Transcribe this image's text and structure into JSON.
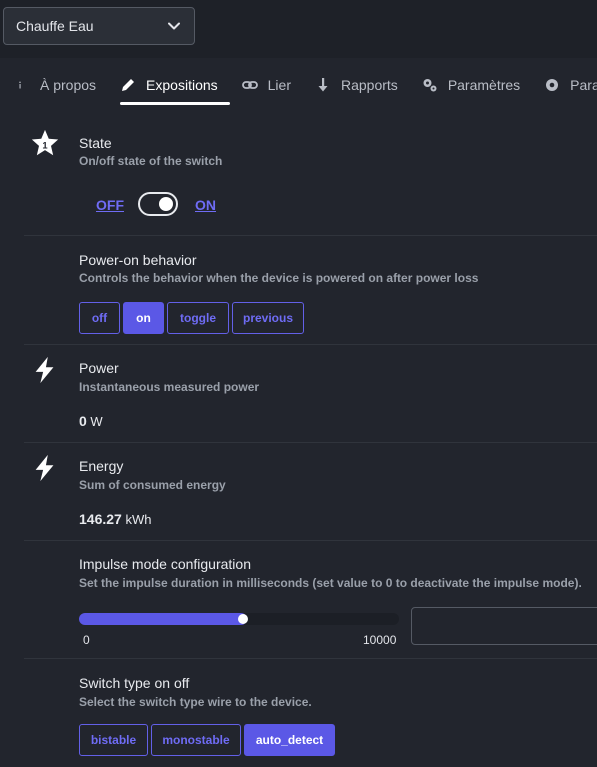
{
  "device_select": {
    "value": "Chauffe Eau"
  },
  "tabs": [
    {
      "label": "À propos",
      "icon": "info-icon"
    },
    {
      "label": "Expositions",
      "icon": "pencil-icon",
      "active": true
    },
    {
      "label": "Lier",
      "icon": "link-icon"
    },
    {
      "label": "Rapports",
      "icon": "arrow-down-icon"
    },
    {
      "label": "Paramètres",
      "icon": "cogs-icon"
    },
    {
      "label": "Param",
      "icon": "gear-icon"
    }
  ],
  "state": {
    "title": "State",
    "description": "On/off state of the switch",
    "off_label": "OFF",
    "on_label": "ON",
    "value": "ON"
  },
  "power_on_behavior": {
    "title": "Power-on behavior",
    "description": "Controls the behavior when the device is powered on after power loss",
    "options": [
      "off",
      "on",
      "toggle",
      "previous"
    ],
    "selected": "on"
  },
  "power": {
    "title": "Power",
    "description": "Instantaneous measured power",
    "value": "0",
    "unit": "W"
  },
  "energy": {
    "title": "Energy",
    "description": "Sum of consumed energy",
    "value": "146.27",
    "unit": "kWh"
  },
  "impulse": {
    "title": "Impulse mode configuration",
    "description": "Set the impulse duration in milliseconds (set value to 0 to deactivate the impulse mode).",
    "min_label": "0",
    "max_label": "10000",
    "fill_fraction": 0.5,
    "input_value": ""
  },
  "switch_type": {
    "title": "Switch type on off",
    "description": "Select the switch type wire to the device.",
    "options": [
      "bistable",
      "monostable",
      "auto_detect"
    ],
    "selected": "auto_detect"
  },
  "colors": {
    "accent": "#5b58e6",
    "background": "#22252d",
    "link": "#6f6cf5"
  }
}
